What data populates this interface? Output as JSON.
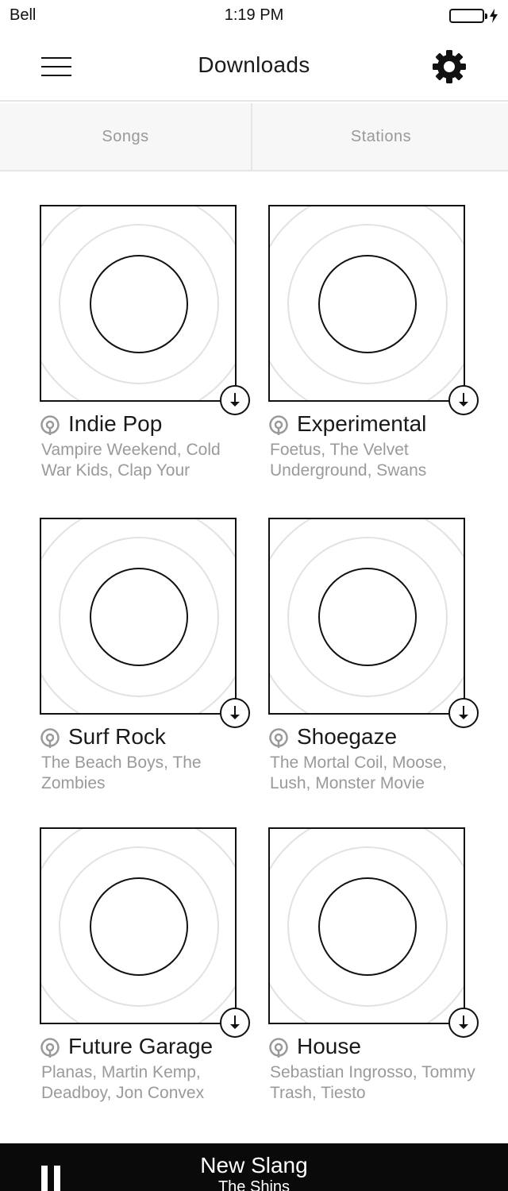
{
  "status_bar": {
    "carrier": "Bell",
    "time": "1:19 PM"
  },
  "header": {
    "title": "Downloads"
  },
  "tabs": [
    {
      "label": "Songs"
    },
    {
      "label": "Stations"
    }
  ],
  "stations": [
    {
      "title": "Indie Pop",
      "artists": "Vampire Weekend, Cold War Kids, Clap Your"
    },
    {
      "title": "Experimental",
      "artists": "Foetus, The Velvet Underground, Swans"
    },
    {
      "title": "Surf Rock",
      "artists": "The Beach Boys, The Zombies"
    },
    {
      "title": "Shoegaze",
      "artists": "The Mortal Coil, Moose, Lush, Monster Movie"
    },
    {
      "title": "Future Garage",
      "artists": "Planas, Martin Kemp, Deadboy, Jon Convex"
    },
    {
      "title": "House",
      "artists": "Sebastian Ingrosso, Tommy Trash, Tiesto"
    }
  ],
  "now_playing": {
    "title": "New Slang",
    "artist": "The Shins"
  },
  "colors": {
    "text": "#1a1a1a",
    "muted": "#9a9a9a",
    "divider": "#e6e6e6",
    "tab_bg": "#f7f7f7",
    "player_bg": "#0a0a0a"
  }
}
